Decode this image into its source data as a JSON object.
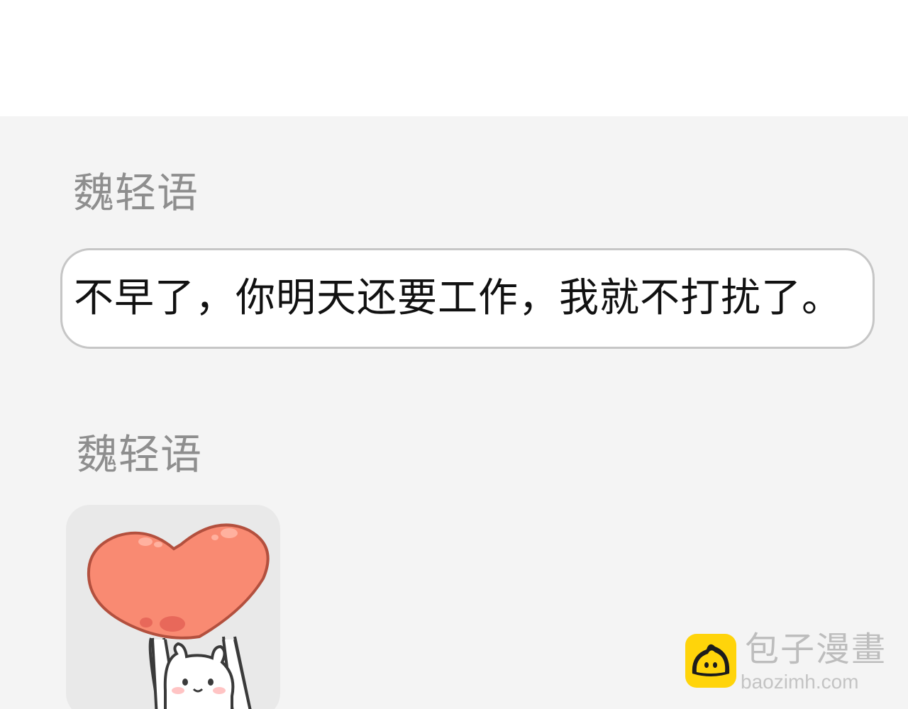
{
  "messages": [
    {
      "sender": "魏轻语",
      "text": "不早了，你明天还要工作，我就不打扰了。"
    },
    {
      "sender": "魏轻语",
      "sticker": "heart-bunny-sticker"
    }
  ],
  "watermark": {
    "brand": "包子漫畫",
    "url": "baozimh.com"
  },
  "colors": {
    "background": "#f4f4f4",
    "top_band": "#ffffff",
    "bubble_border": "#c6c6c6",
    "sender_name": "#8e8e8e",
    "heart": "#f98a72",
    "watermark_logo": "#ffd40a"
  }
}
